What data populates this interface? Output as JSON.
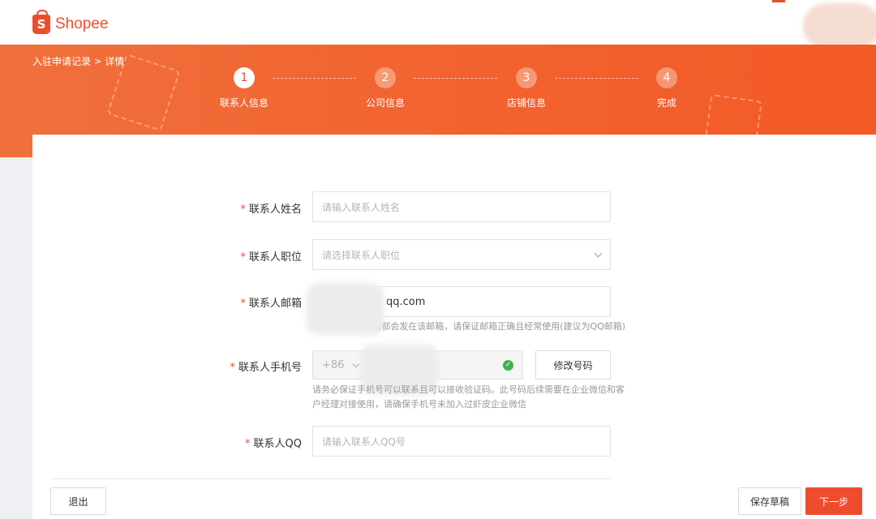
{
  "header": {
    "logo_text": "Shopee",
    "logo_letter": "S"
  },
  "breadcrumb": {
    "parent": "入驻申请记录",
    "separator": ">",
    "current": "详情"
  },
  "steps": [
    {
      "number": "1",
      "label": "联系人信息",
      "active": true
    },
    {
      "number": "2",
      "label": "公司信息",
      "active": false
    },
    {
      "number": "3",
      "label": "店铺信息",
      "active": false
    },
    {
      "number": "4",
      "label": "完成",
      "active": false
    }
  ],
  "form": {
    "required_mark": "*",
    "name": {
      "label": "联系人姓名",
      "placeholder": "请输入联系人姓名"
    },
    "position": {
      "label": "联系人职位",
      "placeholder": "请选择联系人职位"
    },
    "email": {
      "label": "联系人邮箱",
      "value": "qq.com",
      "hint": "Shopee注册邮箱都会发在该邮箱，请保证邮箱正确且经常使用(建议为QQ邮箱)"
    },
    "phone": {
      "label": "联系人手机号",
      "country_code": "+86",
      "modify_button": "修改号码",
      "hint_line1": "请务必保证手机号可以联系且可以接收验证码。此号码后续需要在企业微信和客",
      "hint_line2": "户经理对接使用，请确保手机号未加入过虾皮企业微信"
    },
    "qq": {
      "label": "联系人QQ",
      "placeholder": "请输入联系人QQ号"
    }
  },
  "footer": {
    "exit_label": "退出",
    "save_draft_label": "保存草稿",
    "next_label": "下一步"
  },
  "colors": {
    "accent": "#ee4d2d",
    "banner": "#f2622f",
    "verified": "#39b54a"
  }
}
